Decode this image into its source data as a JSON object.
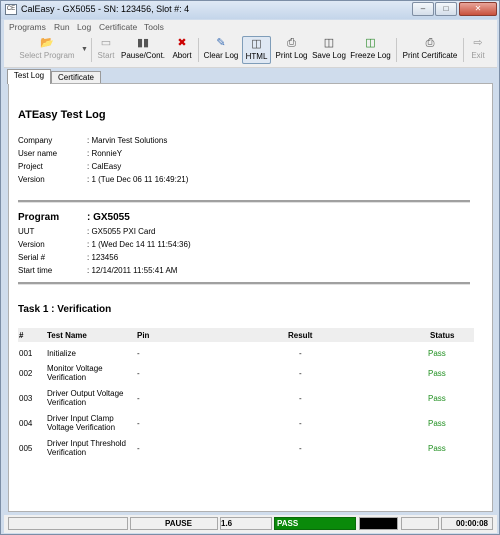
{
  "window": {
    "title": "CalEasy - GX5055 - SN: 123456, Slot #: 4"
  },
  "menu": [
    "Programs",
    "Run",
    "Log",
    "Certificate",
    "Tools"
  ],
  "toolbar": {
    "select_program": "Select Program",
    "start": "Start",
    "pause": "Pause/Cont.",
    "abort": "Abort",
    "clear_log": "Clear Log",
    "html": "HTML",
    "print_log": "Print Log",
    "save_log": "Save Log",
    "freeze_log": "Freeze Log",
    "print_certificate": "Print Certificate",
    "exit": "Exit"
  },
  "tabs": [
    "Test Log",
    "Certificate"
  ],
  "log": {
    "title": "ATEasy Test Log",
    "header_fields": [
      {
        "label": "Company",
        "value": ": Marvin Test Solutions"
      },
      {
        "label": "User name",
        "value": ": RonnieY"
      },
      {
        "label": "Project",
        "value": ": CalEasy"
      },
      {
        "label": "Version",
        "value": ": 1 (Tue Dec 06 11 16:49:21)"
      }
    ],
    "program_label": "Program",
    "program_value": ": GX5055",
    "program_fields": [
      {
        "label": "UUT",
        "value": ": GX5055 PXI Card"
      },
      {
        "label": "Version",
        "value": ": 1 (Wed Dec 14 11 11:54:36)"
      },
      {
        "label": "Serial #",
        "value": ": 123456"
      },
      {
        "label": "Start time",
        "value": ": 12/14/2011 11:55:41 AM"
      }
    ],
    "task_title": "Task 1 : Verification",
    "columns": [
      "#",
      "Test Name",
      "Pin",
      "Result",
      "Status"
    ],
    "rows": [
      {
        "num": "001",
        "name": [
          "Initialize"
        ],
        "pin": "-",
        "result": "-",
        "status": "Pass"
      },
      {
        "num": "002",
        "name": [
          "Monitor Voltage",
          "Verification"
        ],
        "pin": "-",
        "result": "-",
        "status": "Pass"
      },
      {
        "num": "003",
        "name": [
          "Driver Output Voltage",
          "Verification"
        ],
        "pin": "-",
        "result": "-",
        "status": "Pass"
      },
      {
        "num": "004",
        "name": [
          "Driver Input Clamp",
          "Voltage Verification"
        ],
        "pin": "-",
        "result": "-",
        "status": "Pass"
      },
      {
        "num": "005",
        "name": [
          "Driver Input Threshold",
          "Verification"
        ],
        "pin": "-",
        "result": "-",
        "status": "Pass"
      }
    ]
  },
  "status": {
    "state": "PAUSE",
    "number": "1.6",
    "result": "PASS",
    "timer": "00:00:08"
  },
  "colors": {
    "pass": "#1e8f1e",
    "status_pass_bg": "#0a8a0a"
  }
}
